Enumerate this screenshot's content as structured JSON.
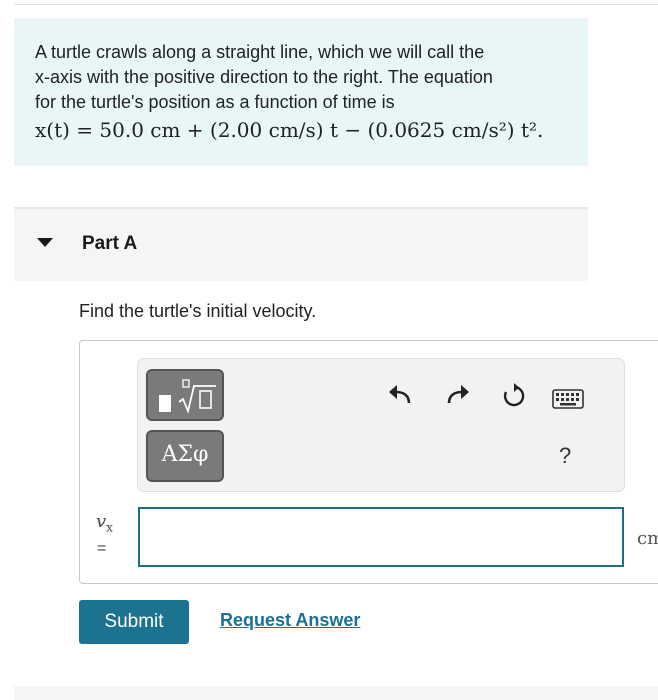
{
  "problem": {
    "line1": "A turtle crawls along a straight line, which we will call the",
    "line2": "x-axis with the positive direction to the right. The equation",
    "line3": "for the turtle's position as a function of time is",
    "equation": "x(t) = 50.0 cm + (2.00 cm/s) t − (0.0625 cm/s²) t²."
  },
  "part": {
    "title": "Part A",
    "question": "Find the turtle's initial velocity."
  },
  "toolbar": {
    "templates_icon": "radical-template-icon",
    "symbols_label": "ΑΣφ",
    "undo_icon": "undo-icon",
    "redo_icon": "redo-icon",
    "reset_icon": "reset-icon",
    "keyboard_icon": "keyboard-icon",
    "help_label": "?"
  },
  "answer": {
    "variable": "v",
    "subscript": "x",
    "equals": "=",
    "value": "",
    "unit": "cm"
  },
  "actions": {
    "submit_label": "Submit",
    "request_label": "Request Answer"
  },
  "colors": {
    "intro_bg": "#e8f6f6",
    "accent": "#1b7390",
    "link": "#1b6f99"
  }
}
